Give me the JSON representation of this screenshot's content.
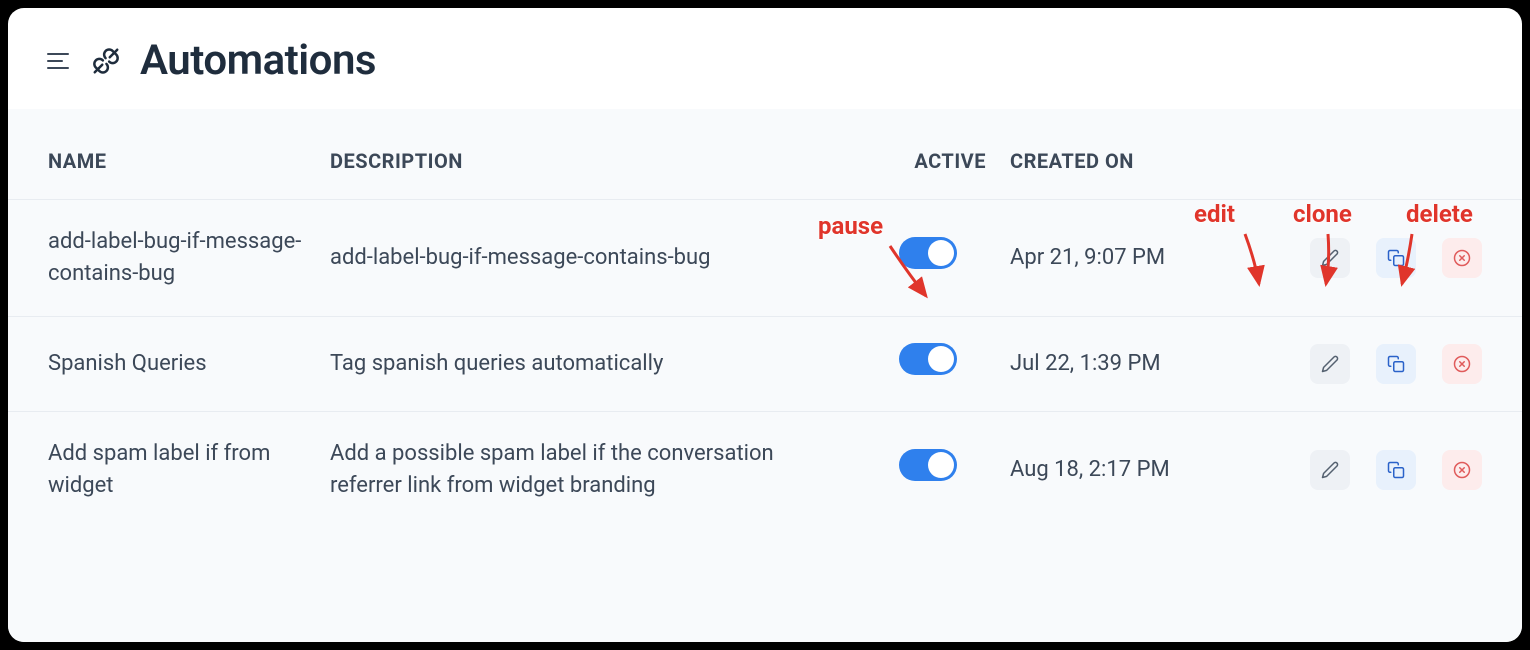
{
  "header": {
    "title": "Automations"
  },
  "columns": {
    "name": "NAME",
    "description": "DESCRIPTION",
    "active": "ACTIVE",
    "created": "CREATED ON"
  },
  "rows": [
    {
      "name": "add-label-bug-if-message-contains-bug",
      "description": "add-label-bug-if-message-contains-bug",
      "active": true,
      "created": "Apr 21, 9:07 PM"
    },
    {
      "name": "Spanish Queries",
      "description": "Tag spanish queries automatically",
      "active": true,
      "created": "Jul 22, 1:39 PM"
    },
    {
      "name": "Add spam label if from widget",
      "description": "Add a possible spam label if the conversation referrer link from widget branding",
      "active": true,
      "created": "Aug 18, 2:17 PM"
    }
  ],
  "annotations": {
    "pause": "pause",
    "edit": "edit",
    "clone": "clone",
    "delete": "delete"
  }
}
